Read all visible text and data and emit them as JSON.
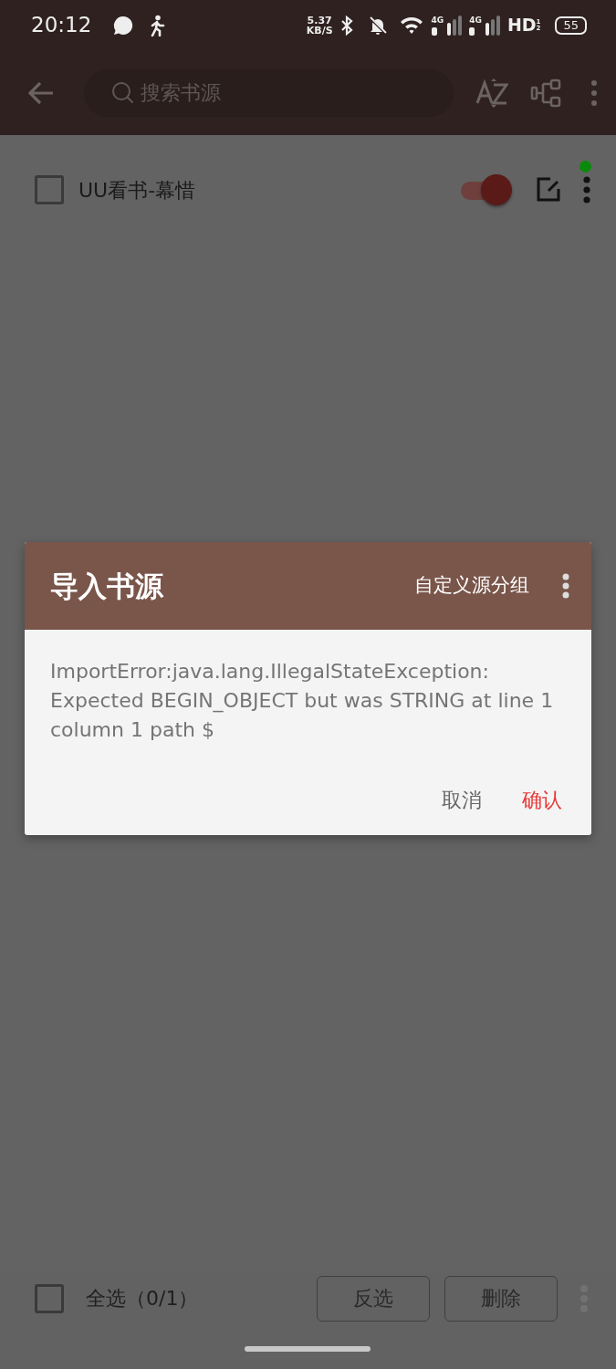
{
  "status_bar": {
    "time": "20:12",
    "speed_value": "5.37",
    "speed_unit": "KB/S",
    "signals": [
      {
        "label": "4G"
      },
      {
        "label": "4G"
      }
    ],
    "hd": "HD",
    "hd_slots": [
      "1",
      "2"
    ],
    "battery": "55"
  },
  "toolbar": {
    "search": {
      "placeholder": "搜索书源"
    }
  },
  "sources": [
    {
      "name": "UU看书-幕惜",
      "checked": false,
      "enabled": true
    }
  ],
  "dialog": {
    "title": "导入书源",
    "action": "自定义源分组",
    "message": "ImportError:java.lang.IllegalStateException: Expected BEGIN_OBJECT but was STRING at line 1 column 1 path $",
    "buttons": [
      {
        "label": "取消",
        "kind": "neutral"
      },
      {
        "label": "确认",
        "kind": "positive"
      }
    ]
  },
  "bottom_bar": {
    "select_all": {
      "label": "全选（0/1）",
      "checked": false
    },
    "buttons": [
      "反选",
      "删除"
    ]
  }
}
